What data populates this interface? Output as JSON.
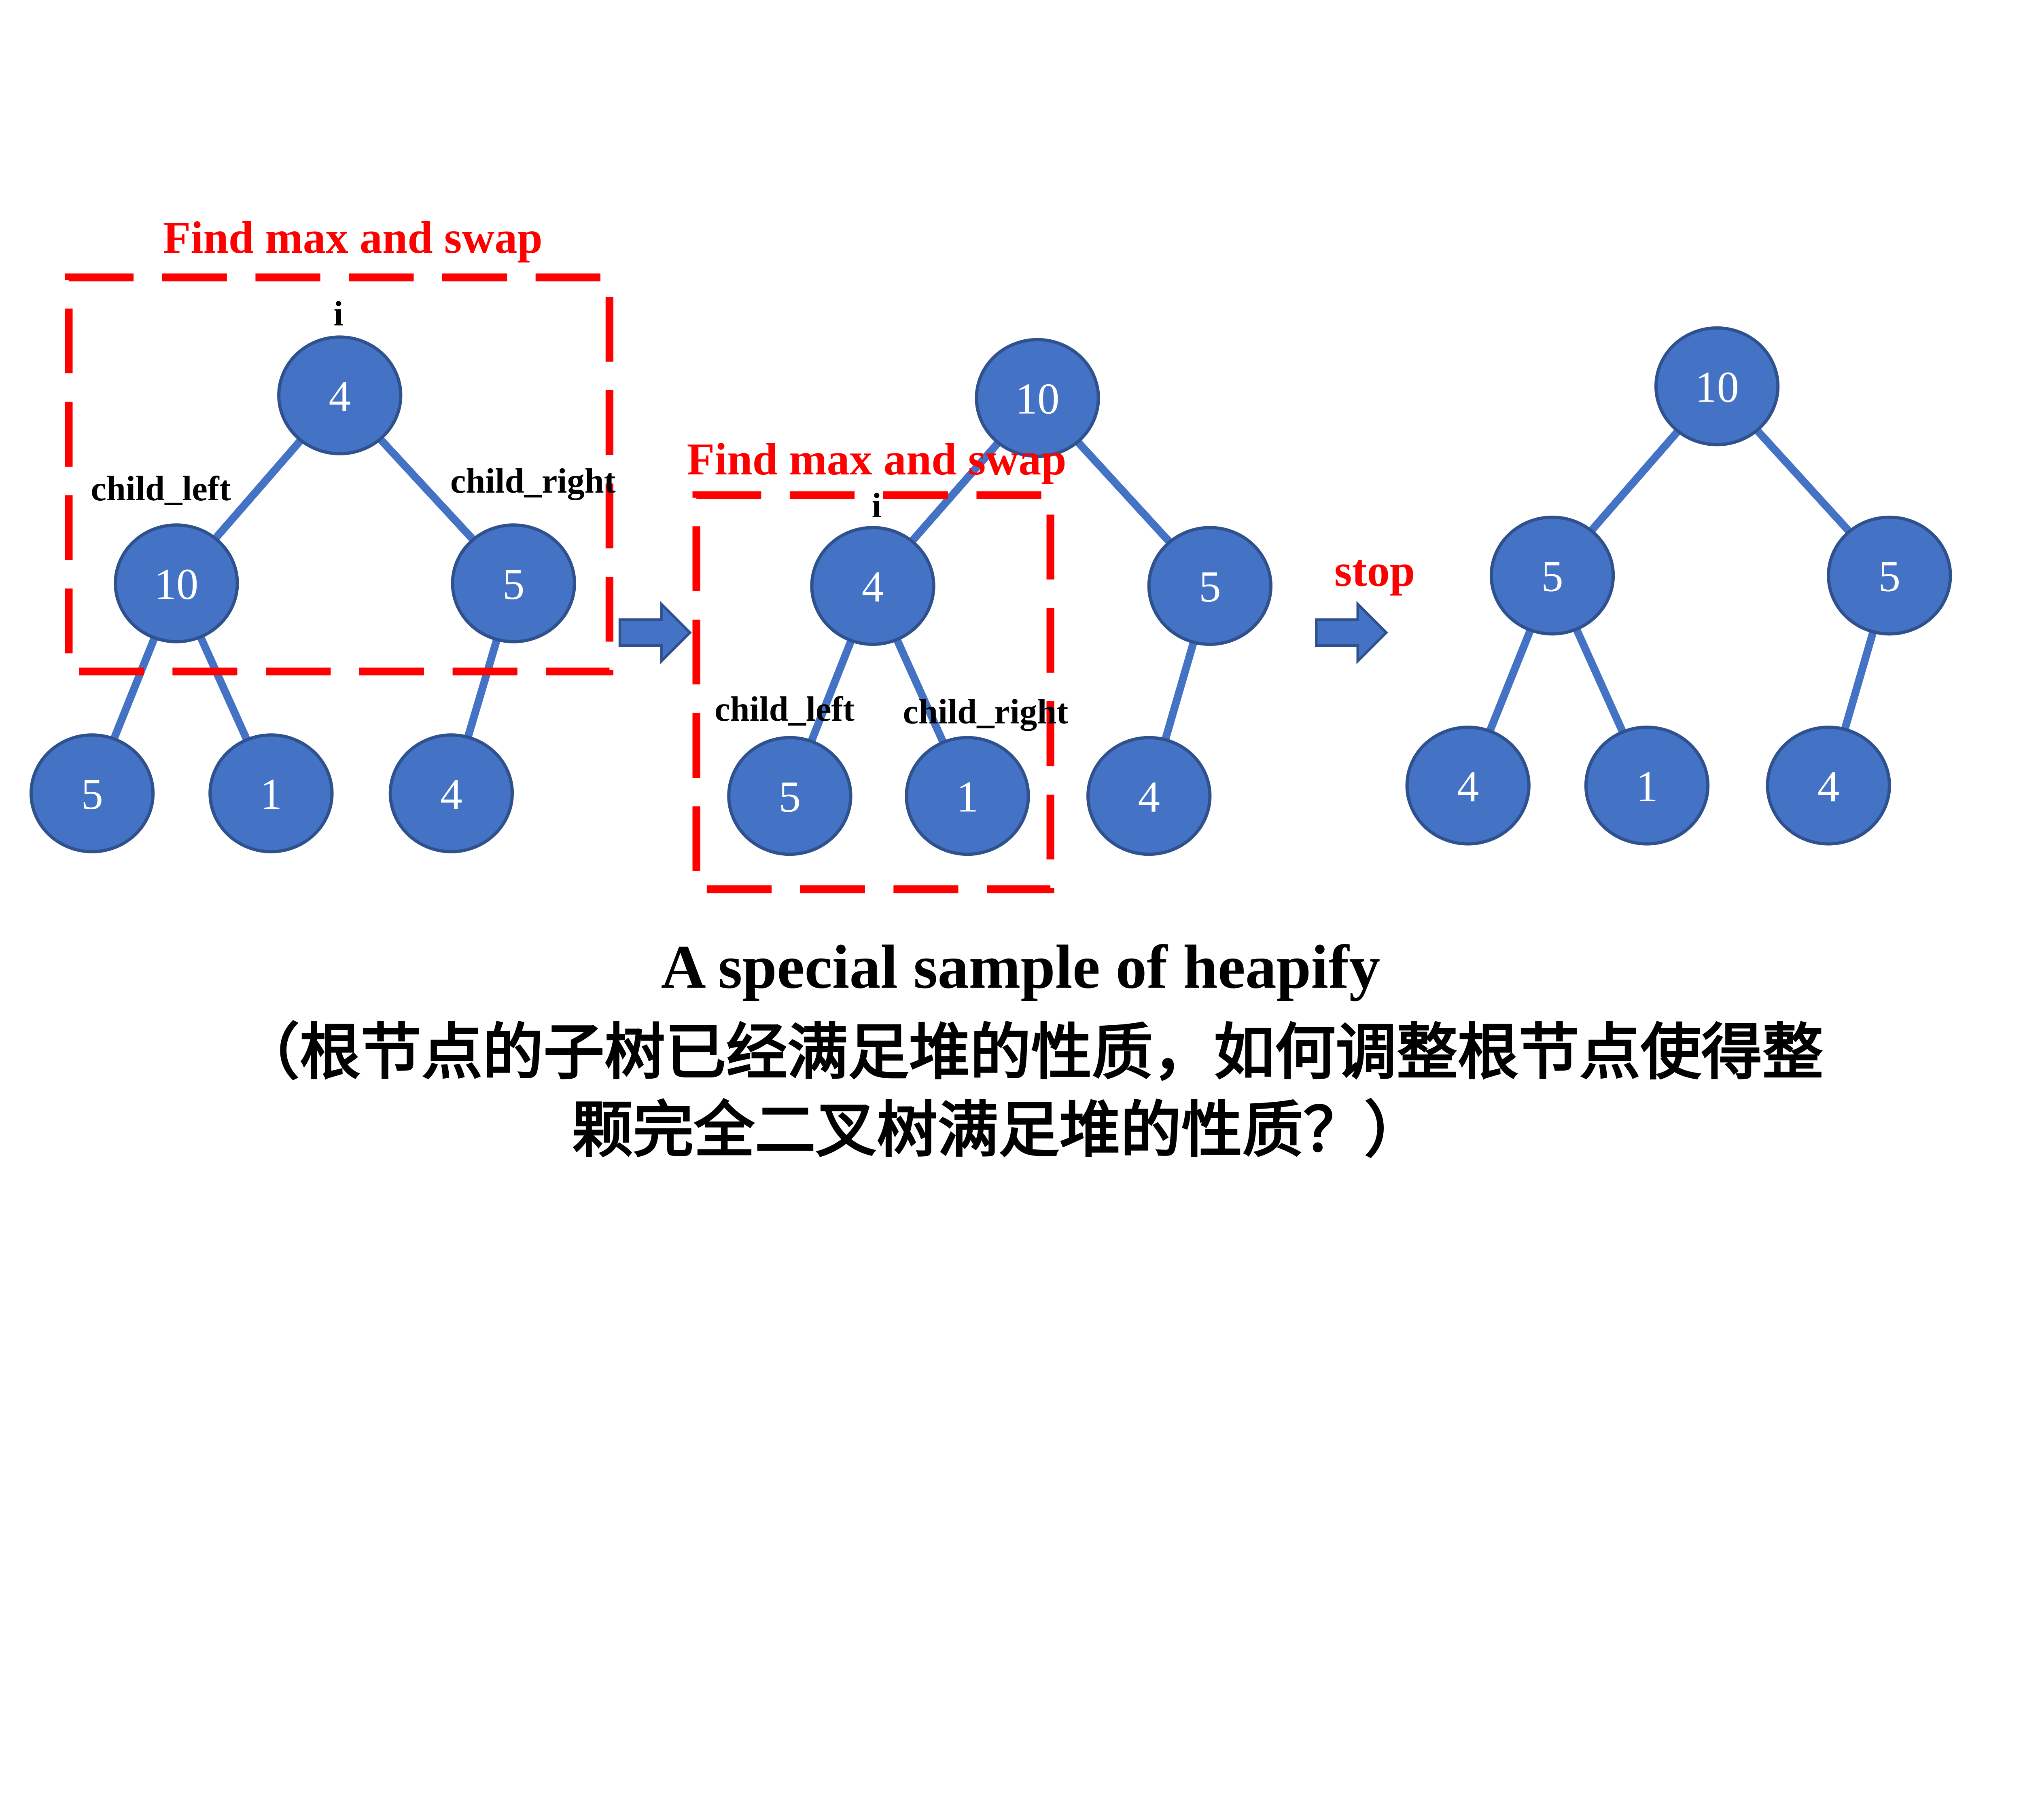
{
  "colors": {
    "node_fill": "#4472C4",
    "node_stroke": "#2F528F",
    "edge": "#4472C4",
    "highlight": "#FF0000"
  },
  "trees": [
    {
      "nodes": [
        "4",
        "10",
        "5",
        "5",
        "1",
        "4"
      ]
    },
    {
      "nodes": [
        "10",
        "4",
        "5",
        "5",
        "1",
        "4"
      ]
    },
    {
      "nodes": [
        "10",
        "5",
        "5",
        "4",
        "1",
        "4"
      ]
    }
  ],
  "step1": {
    "caption": "Find max and swap",
    "i_label": "i",
    "left_label": "child_left",
    "right_label": "child_right"
  },
  "step2": {
    "caption": "Find max and swap",
    "i_label": "i",
    "left_label": "child_left",
    "right_label": "child_right"
  },
  "stop_label": "stop",
  "title": "A special sample of heapify",
  "subtitle_line1": "（根节点的子树已经满足堆的性质，如何调整根节点使得整",
  "subtitle_line2": "颗完全二叉树满足堆的性质？）"
}
